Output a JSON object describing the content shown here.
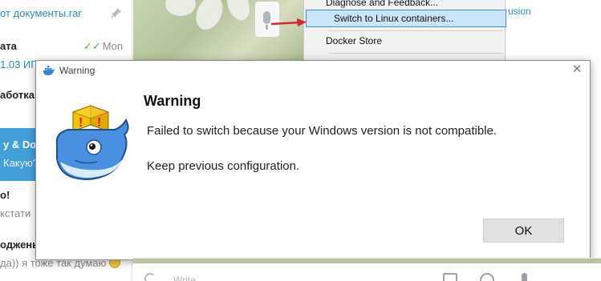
{
  "chat": {
    "items": [
      {
        "line1": "от документы.rar"
      },
      {
        "line1": "ата",
        "time": "Mon",
        "line2": "1.03 ИГ"
      },
      {
        "line1": "аботка"
      },
      {
        "active_title": "y & Doc",
        "active_sub": "Какую?"
      },
      {
        "line1": "о!",
        "line2": "кстати"
      },
      {
        "line1": "оджены",
        "line2": "да)) я тоже так думаю"
      }
    ],
    "compose_placeholder": "Write",
    "link_fragment": "usion"
  },
  "menu": {
    "items": [
      {
        "label": "Diagnose and Feedback..."
      },
      {
        "label": "Switch to Linux containers...",
        "highlighted": true
      },
      {
        "label": "Docker Store"
      }
    ]
  },
  "dialog": {
    "window_title": "Warning",
    "heading": "Warning",
    "message": "Failed to switch because your Windows version is not compatible.",
    "sub_message": "Keep previous configuration.",
    "ok_label": "OK",
    "close_glyph": "✕",
    "icon": "docker-whale-warning-icon"
  },
  "colors": {
    "selection": "#cce4f7",
    "selection_border": "#3a8ee0",
    "active_chat": "#419fd9",
    "arrow": "#d9232d",
    "whale": "#4a90e2",
    "warning_box": "#f5c400"
  }
}
